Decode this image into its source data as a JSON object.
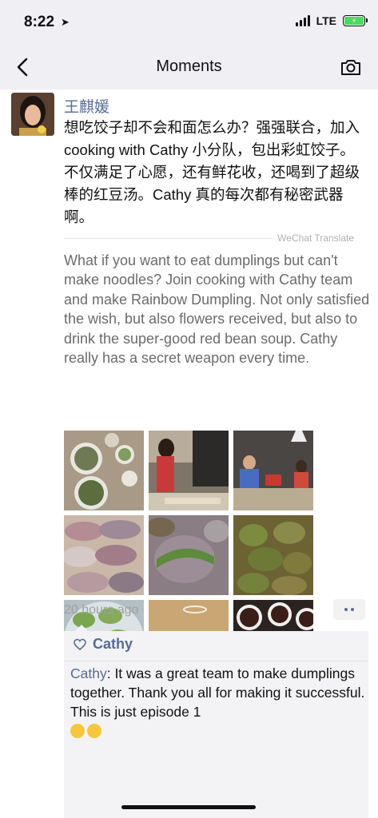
{
  "status": {
    "time": "8:22",
    "network": "LTE"
  },
  "nav": {
    "title": "Moments"
  },
  "post": {
    "author": "王麒媛",
    "text": "想吃饺子却不会和面怎么办？强强联合，加入cooking with Cathy 小分队，包出彩虹饺子。不仅满足了心愿，还有鲜花收，还喝到了超级棒的红豆汤。Cathy 真的每次都有秘密武器啊。",
    "translate_label": "WeChat Translate",
    "translation": "What if you want to eat dumplings but can't make noodles? Join cooking with Cathy team and make Rainbow Dumpling. Not only satisfied the wish, but also flowers received, but also to drink the super-good red bean soup. Cathy really has a secret weapon every time.",
    "timestamp": "20 hours ago",
    "photos": [
      "dumpling-ingredients-photo",
      "person-cooking-photo",
      "kitchen-group-photo",
      "raw-dumplings-photo",
      "rainbow-dumplings-closeup-photo",
      "fried-dumplings-photo",
      "green-dumplings-plate-photo",
      "dinner-table-group-photo",
      "red-bean-soup-bowls-photo"
    ]
  },
  "likes": {
    "names": "Cathy"
  },
  "comment": {
    "author": "Cathy",
    "text": ": It was a great team to make dumplings together. Thank you all for making it successful. This is just episode 1"
  },
  "colors": {
    "link": "#576b95",
    "bar": "#efeff4",
    "battery": "#4cd964"
  }
}
